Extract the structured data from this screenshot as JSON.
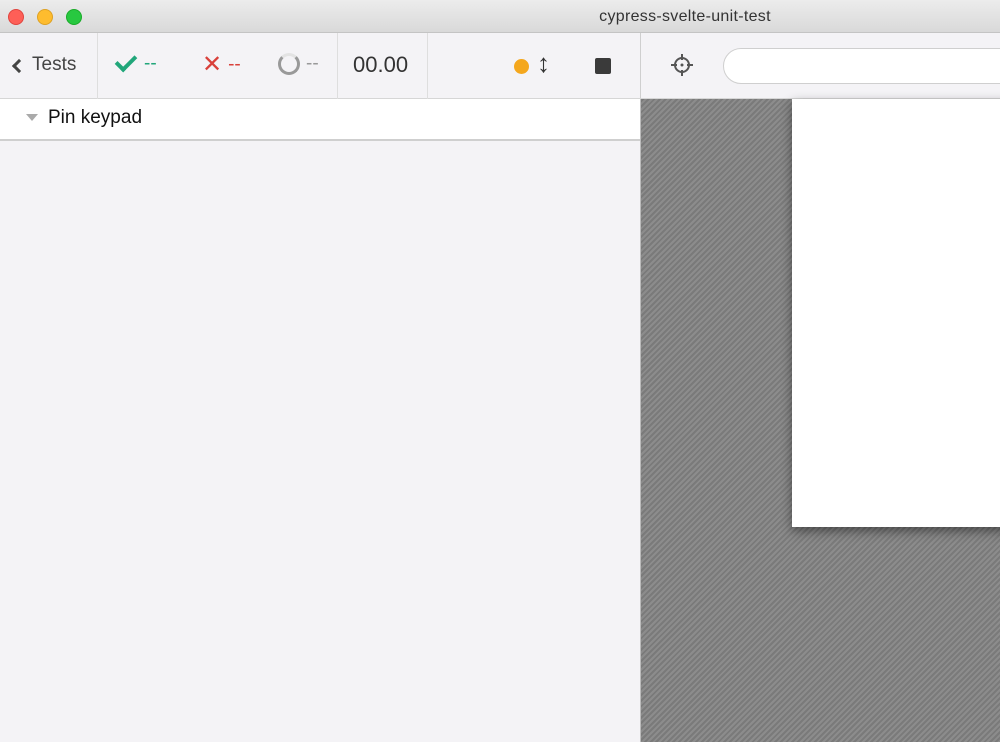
{
  "window": {
    "title": "cypress-svelte-unit-test"
  },
  "header": {
    "back_label": "Tests",
    "passed": "--",
    "failed": "--",
    "pending": "--",
    "duration": "00.00"
  },
  "colors": {
    "passed": "#21a67a",
    "failed": "#d9403a",
    "pending": "#999999",
    "running_dot": "#f4a71d"
  },
  "icons": [
    "chevron-left-icon",
    "check-icon",
    "x-icon",
    "spinner-icon",
    "status-dot-icon",
    "arrows-vertical-icon",
    "stop-icon",
    "crosshair-icon"
  ],
  "suite": {
    "title": "Pin keypad"
  }
}
